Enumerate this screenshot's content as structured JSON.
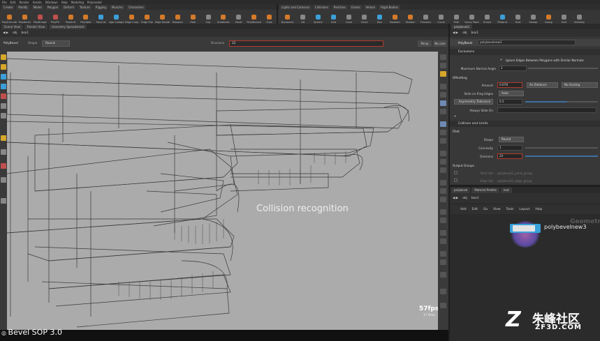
{
  "menubar": {
    "items": [
      "File",
      "Edit",
      "Render",
      "Assets",
      "Windows",
      "Help",
      "Modeling",
      "Polymodel"
    ]
  },
  "shelf_tabs_left": [
    "Create",
    "Modify",
    "Model",
    "Polygon",
    "Deform",
    "Texture",
    "Rigging",
    "Muscles",
    "Characters"
  ],
  "shelf_tabs_right": [
    "Lights and Cameras",
    "Collisions",
    "Particles",
    "Grains",
    "Vellum",
    "Rigid Bodies"
  ],
  "shelf_tools_left": [
    {
      "label": "PolyExtrude",
      "color": "#d47a2a"
    },
    {
      "label": "PolyBevel",
      "color": "#d47a2a"
    },
    {
      "label": "PolyBridge",
      "color": "#c0504d"
    },
    {
      "label": "PolyFill",
      "color": "#c0504d"
    },
    {
      "label": "PolyKnit",
      "color": "#d47a2a"
    },
    {
      "label": "PolySplit",
      "color": "#d47a2a"
    },
    {
      "label": "PolyCut",
      "color": "#3d9fd9"
    },
    {
      "label": "Edge Collapse",
      "color": "#3d9fd9"
    },
    {
      "label": "Edge Cusp",
      "color": "#d47a2a"
    },
    {
      "label": "Edge Flip",
      "color": "#d47a2a"
    },
    {
      "label": "Edge Divide",
      "color": "#d47a2a"
    },
    {
      "label": "Dissolve",
      "color": "#d47a2a"
    },
    {
      "label": "Hole",
      "color": "#d47a2a"
    },
    {
      "label": "Clip",
      "color": "#888"
    },
    {
      "label": "Subdivide",
      "color": "#d47a2a"
    },
    {
      "label": "Facet",
      "color": "#888"
    },
    {
      "label": "PolyReduce",
      "color": "#d47a2a"
    },
    {
      "label": "Fuse",
      "color": "#d47a2a"
    }
  ],
  "shelf_tools_right": [
    {
      "label": "Dynamics",
      "color": "#d47a2a"
    },
    {
      "label": "Lift",
      "color": "#888"
    },
    {
      "label": "Sphere",
      "color": "#3d9fd9"
    },
    {
      "label": "Grid",
      "color": "#3d9fd9"
    },
    {
      "label": "Cone",
      "color": "#888"
    },
    {
      "label": "Circle",
      "color": "#888"
    },
    {
      "label": "Box",
      "color": "#3d9fd9"
    },
    {
      "label": "Boolean",
      "color": "#d47a2a"
    },
    {
      "label": "Shatter",
      "color": "#d47a2a"
    },
    {
      "label": "Fracture",
      "color": "#888"
    },
    {
      "label": "Curve",
      "color": "#888"
    },
    {
      "label": "Path",
      "color": "#888"
    },
    {
      "label": "Spray Paint",
      "color": "#888"
    },
    {
      "label": "Sculpt",
      "color": "#888"
    },
    {
      "label": "Platonic",
      "color": "#3d9fd9"
    },
    {
      "label": "Font",
      "color": "#888"
    },
    {
      "label": "Sweep",
      "color": "#888"
    },
    {
      "label": "Group",
      "color": "#d47a2a"
    },
    {
      "label": "Edit",
      "color": "#888"
    },
    {
      "label": "Visibility",
      "color": "#888"
    }
  ],
  "pane_tabs": [
    "Scene View",
    "Render View",
    "Geometry Spreadsheet"
  ],
  "path_bar": {
    "obj": "obj",
    "node": "box1"
  },
  "op_bar": {
    "node_name": "PolyBevel",
    "shape_label": "Shape",
    "shape_value": "Round",
    "field_value": "22"
  },
  "viewport": {
    "caption": "Collision recognition",
    "fps": "57fps",
    "stats": "17.6ms"
  },
  "bottom_label": "Bevel SOP 3.0",
  "right_tabs": [
    "polybevel3"
  ],
  "right_path": {
    "obj": "obj",
    "node": "box1"
  },
  "params": {
    "header_type": "PolyBevel",
    "header_name": "polybevelnew1",
    "exclusions_title": "Exclusions",
    "ignore_label": "Ignore Edges Between Polygons with Similar Normals",
    "max_normal_angle_label": "Maximum Normal Angle",
    "max_normal_angle_value": "2",
    "offsetting_title": "Offsetting",
    "amount_label": "Amount",
    "amount_value": "0.078",
    "as_distance": "As Distance",
    "no_scaling": "No Scaling",
    "slide_label": "Slide on Ring Edges",
    "slide_value": "Auto",
    "asym_label": "Asymmetry Tolerance",
    "asym_value": "0.5",
    "always_slide_label": "Always Slide On",
    "collision_title": "Collision and Limits",
    "fillet_title": "Fillet",
    "shape_label": "Shape",
    "shape_value": "Round",
    "convexity_label": "Convexity",
    "convexity_value": "1",
    "divisions_label": "Divisions",
    "divisions_value": "22",
    "output_title": "Output Groups",
    "point_set_label": "Point Set",
    "edge_set_label": "Edge Set",
    "point_set_value": "polybevel1_point_group",
    "edge_set_value": "polybevel1_edge_group"
  },
  "net_tabs": [
    "polybevel",
    "Material Palette",
    "/out"
  ],
  "net_path": {
    "obj": "obj",
    "node": "box1"
  },
  "net_menu": [
    "Add",
    "Edit",
    "Go",
    "View",
    "Tools",
    "Layout",
    "Help"
  ],
  "network": {
    "node_label": "polybevelnew3",
    "bg_text": "Geometry"
  },
  "watermark": {
    "logo": "Z",
    "cn": "朱峰社区",
    "url": "ZF3D.COM"
  },
  "colors": {
    "viewport_bg": "#ababab",
    "accent_red": "#c0392b",
    "node_blue": "#3aa0d8"
  }
}
